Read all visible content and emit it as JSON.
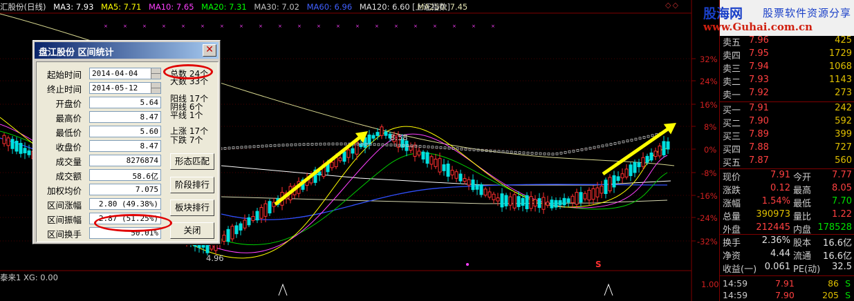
{
  "chart": {
    "stock_title": "汇股份(日线)",
    "ma_labels": [
      {
        "text": "MA3: 7.93",
        "color": "#ffffff"
      },
      {
        "text": "MA5: 7.71",
        "color": "#ffff00"
      },
      {
        "text": "MA10: 7.65",
        "color": "#ff40ff"
      },
      {
        "text": "MA20: 7.31",
        "color": "#00ff00"
      },
      {
        "text": "MA30: 7.02",
        "color": "#c0c0c0"
      },
      {
        "text": "MA60: 6.96",
        "color": "#4060ff"
      },
      {
        "text": "MA120: 6.60",
        "color": "#e0e0e0"
      },
      {
        "text": "MA250: 7.45",
        "color": "#e0e0b0"
      }
    ],
    "index_label": "[上证指数]",
    "diamonds": "◇◇",
    "axis_labels": [
      "32%",
      "24%",
      "16%",
      "8%",
      "0%",
      "-8%",
      "-16%",
      "-24%",
      "-32%"
    ],
    "high_mark": "8.58",
    "low_mark": "4.96",
    "indicator_label": "泰来1 XG: 0.00",
    "indicator_axis": "1.00",
    "s_marker": "S"
  },
  "dialog": {
    "title": "盘江股份  区间统计",
    "close": "✕",
    "fields": [
      {
        "label": "起始时间",
        "value": "2014-04-04"
      },
      {
        "label": "终止时间",
        "value": "2014-05-12"
      },
      {
        "label": "开盘价",
        "value": "5.64"
      },
      {
        "label": "最高价",
        "value": "8.47"
      },
      {
        "label": "最低价",
        "value": "5.60"
      },
      {
        "label": "收盘价",
        "value": "8.47"
      },
      {
        "label": "成交量",
        "value": "8276874"
      },
      {
        "label": "成交额",
        "value": "58.6亿"
      },
      {
        "label": "加权均价",
        "value": "7.075"
      },
      {
        "label": "区间涨幅",
        "value": "2.80 (49.38%)"
      },
      {
        "label": "区间振幅",
        "value": "2.87 (51.25%)"
      },
      {
        "label": "区间换手",
        "value": "50.01%"
      }
    ],
    "stats": {
      "total": "总数 24个",
      "up_days": "大数 33个",
      "yang": "阳线 17个",
      "yin": "阴线 6个",
      "ping": "平线 1个",
      "rise": "上涨 17个",
      "fall": "下跌 7个"
    },
    "buttons": {
      "pattern": "形态匹配",
      "stage": "阶段排行",
      "sector": "板块排行",
      "close": "关闭"
    }
  },
  "quote": {
    "brand_main": "股海网",
    "brand_sub": "股票软件资源分享",
    "brand_url": "www.Guhai.com.cn",
    "sell": [
      {
        "label": "卖五",
        "price": "7.96",
        "vol": "425"
      },
      {
        "label": "卖四",
        "price": "7.95",
        "vol": "1729"
      },
      {
        "label": "卖三",
        "price": "7.94",
        "vol": "1068"
      },
      {
        "label": "卖二",
        "price": "7.93",
        "vol": "1143"
      },
      {
        "label": "卖一",
        "price": "7.92",
        "vol": "273"
      }
    ],
    "buy": [
      {
        "label": "买一",
        "price": "7.91",
        "vol": "242"
      },
      {
        "label": "买二",
        "price": "7.90",
        "vol": "592"
      },
      {
        "label": "买三",
        "price": "7.89",
        "vol": "399"
      },
      {
        "label": "买四",
        "price": "7.88",
        "vol": "727"
      },
      {
        "label": "买五",
        "price": "7.87",
        "vol": "560"
      }
    ],
    "stats": [
      {
        "l1": "现价",
        "v1": "7.91",
        "c1": "#ff4040",
        "l2": "今开",
        "v2": "7.77",
        "c2": "#ff4040"
      },
      {
        "l1": "涨跌",
        "v1": "0.12",
        "c1": "#ff4040",
        "l2": "最高",
        "v2": "8.05",
        "c2": "#ff4040"
      },
      {
        "l1": "涨幅",
        "v1": "1.54%",
        "c1": "#ff4040",
        "l2": "最低",
        "v2": "7.70",
        "c2": "#00e000"
      },
      {
        "l1": "总量",
        "v1": "390973",
        "c1": "#e0c000",
        "l2": "量比",
        "v2": "1.22",
        "c2": "#ff4040"
      },
      {
        "l1": "外盘",
        "v1": "212445",
        "c1": "#ff4040",
        "l2": "内盘",
        "v2": "178528",
        "c2": "#00e000"
      },
      {
        "l1": "换手",
        "v1": "2.36%",
        "c1": "#e0e0e0",
        "l2": "股本",
        "v2": "16.6亿",
        "c2": "#e0e0e0"
      },
      {
        "l1": "净资",
        "v1": "4.44",
        "c1": "#e0e0e0",
        "l2": "流通",
        "v2": "16.6亿",
        "c2": "#e0e0e0"
      },
      {
        "l1": "收益(一)",
        "v1": "0.061",
        "c1": "#e0e0e0",
        "l2": "PE(动)",
        "v2": "32.5",
        "c2": "#e0e0e0"
      }
    ],
    "ticks": [
      {
        "time": "14:59",
        "price": "7.91",
        "vol": "86",
        "dir": "S",
        "dc": "#00e000"
      },
      {
        "time": "14:59",
        "price": "7.90",
        "vol": "205",
        "dir": "S",
        "dc": "#00e000"
      }
    ]
  }
}
